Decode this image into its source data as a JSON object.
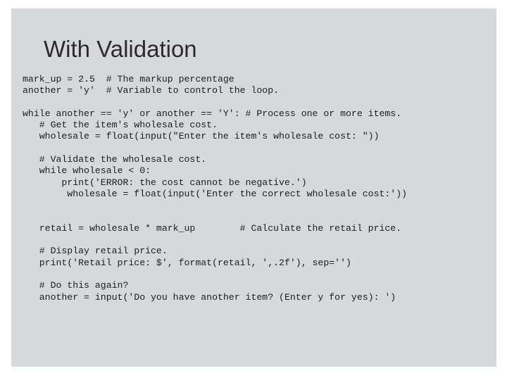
{
  "slide": {
    "title": "With Validation",
    "background_color": "#d6d8dc",
    "page_background_color": "#ffffff",
    "text_color": "#1c1c1c",
    "title_color": "#2b2b2b"
  },
  "code": {
    "language": "python",
    "lines": [
      "mark_up = 2.5  # The markup percentage",
      "another = 'y'  # Variable to control the loop.",
      "",
      "while another == 'y' or another == 'Y': # Process one or more items.",
      "   # Get the item's wholesale cost.",
      "   wholesale = float(input(\"Enter the item's wholesale cost: \"))",
      "",
      "   # Validate the wholesale cost.",
      "   while wholesale < 0:",
      "       print('ERROR: the cost cannot be negative.')",
      "        wholesale = float(input('Enter the correct wholesale cost:'))",
      "",
      "",
      "   retail = wholesale * mark_up        # Calculate the retail price.",
      "",
      "   # Display retail price.",
      "   print('Retail price: $', format(retail, ',.2f'), sep='')",
      "",
      "   # Do this again?",
      "   another = input('Do you have another item? (Enter y for yes): ')"
    ]
  }
}
